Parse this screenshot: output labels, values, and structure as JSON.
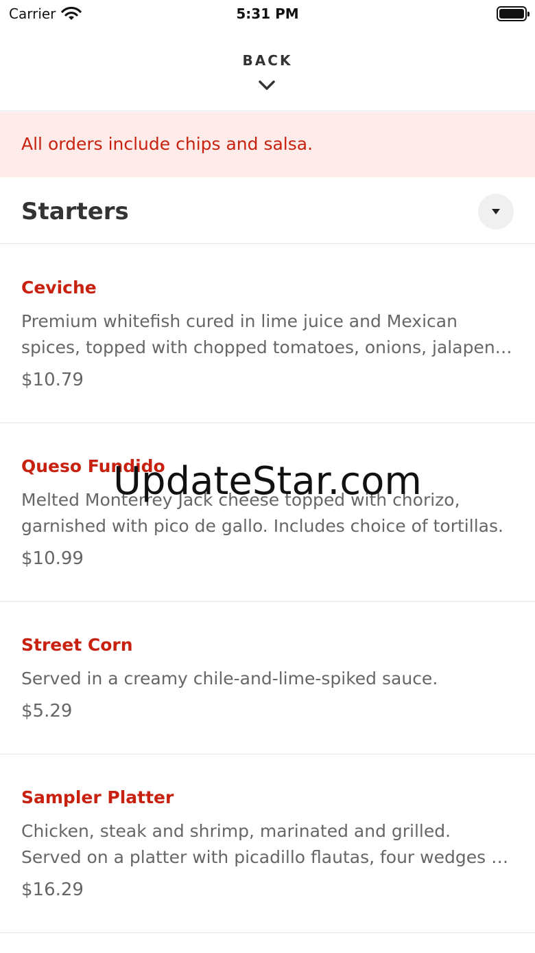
{
  "status_bar": {
    "carrier": "Carrier",
    "time": "5:31 PM"
  },
  "nav": {
    "back_label": "BACK",
    "back_icon": "chevron-down-icon"
  },
  "notice": {
    "text": "All orders include chips and salsa."
  },
  "section": {
    "title": "Starters",
    "toggle_icon": "triangle-down-icon"
  },
  "items": [
    {
      "name": "Ceviche",
      "description": "Premium whitefish cured in lime juice and Mexican spices, topped with chopped tomatoes, onions, jalapeno peppers, cilantro and avocado.",
      "price": "$10.79"
    },
    {
      "name": "Queso Fundido",
      "description": "Melted Monterrey Jack cheese topped with chorizo, garnished with pico de gallo. Includes choice of tortillas.",
      "price": "$10.99"
    },
    {
      "name": "Street Corn",
      "description": "Served in a creamy chile-and-lime-spiked sauce.",
      "price": "$5.29"
    },
    {
      "name": "Sampler Platter",
      "description": "Chicken, steak and shrimp, marinated and grilled. Served on a platter with picadillo flautas, four wedges of cheese quesadilla and guacamole.",
      "price": "$16.29"
    }
  ],
  "watermark": "UpdateStar.com",
  "colors": {
    "accent": "#c8210f",
    "notice_bg": "#fdecea",
    "text": "#333333",
    "muted": "#666666"
  }
}
